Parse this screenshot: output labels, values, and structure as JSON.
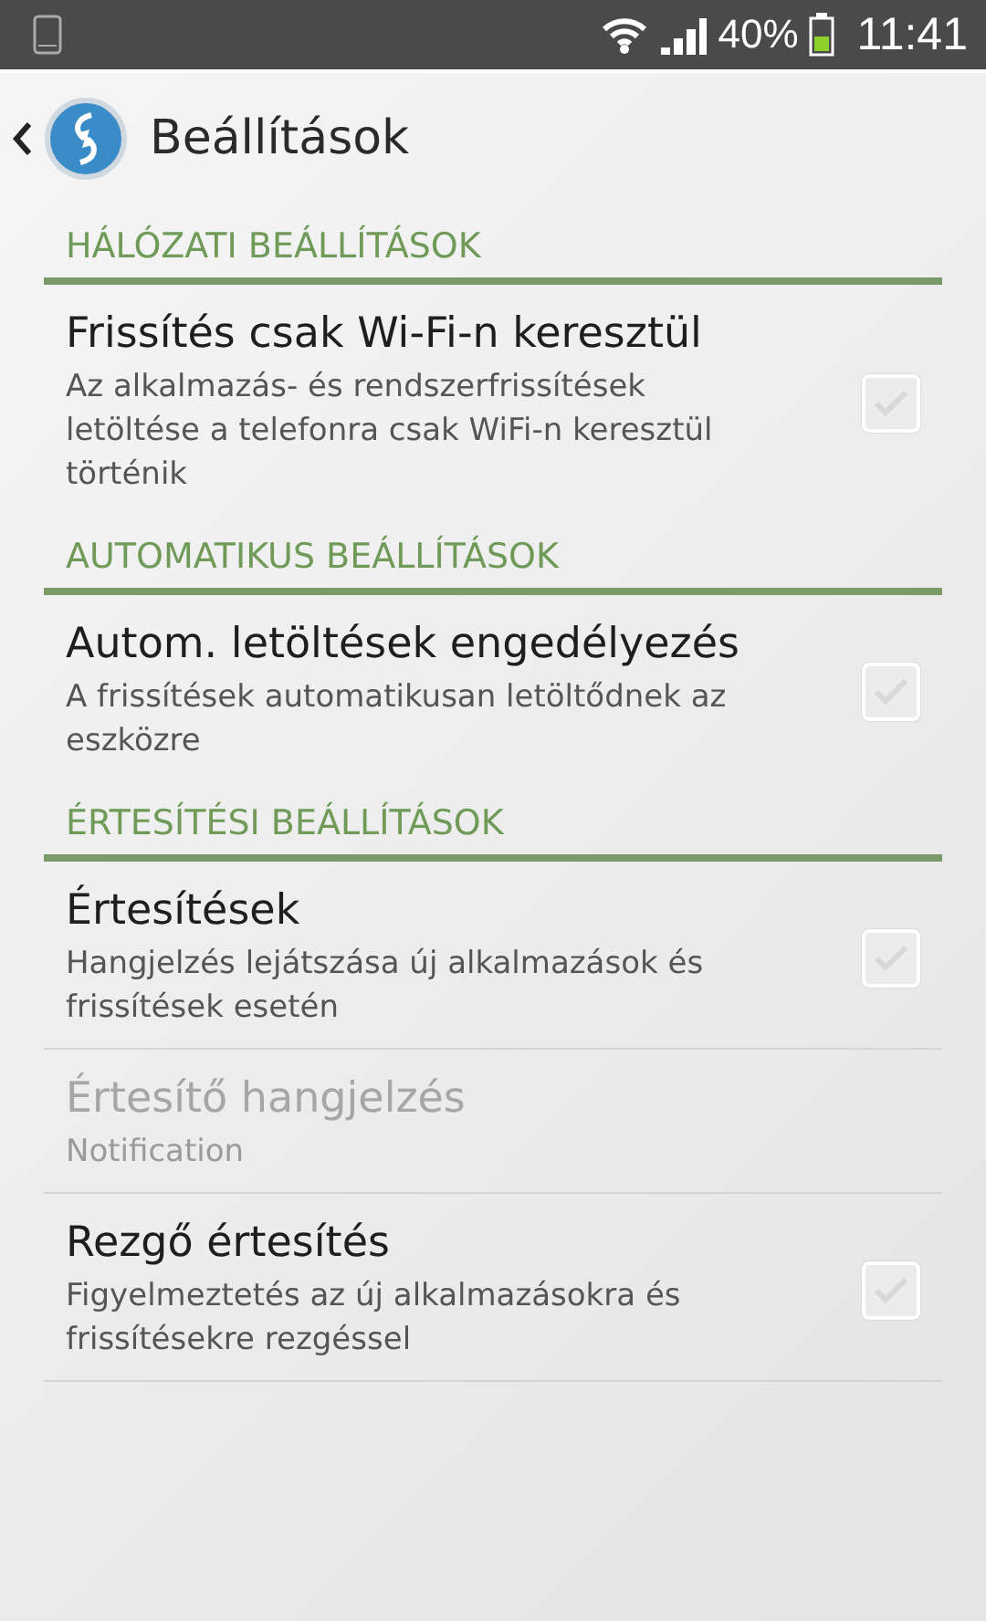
{
  "status_bar": {
    "battery": "40%",
    "time": "11:41"
  },
  "action_bar": {
    "title": "Beállítások"
  },
  "sections": [
    {
      "header": "HÁLÓZATI BEÁLLÍTÁSOK",
      "items": [
        {
          "kind": "checkbox",
          "title": "Frissítés csak Wi-Fi-n keresztül",
          "summary": "Az alkalmazás- és rendszerfrissítések letöltése a telefonra csak WiFi-n keresztül történik",
          "checked": false,
          "disabled": false
        }
      ]
    },
    {
      "header": "AUTOMATIKUS BEÁLLÍTÁSOK",
      "items": [
        {
          "kind": "checkbox",
          "title": "Autom. letöltések engedélyezés",
          "summary": "A frissítések automatikusan letöltődnek az eszközre",
          "checked": false,
          "disabled": false
        }
      ]
    },
    {
      "header": "ÉRTESÍTÉSI BEÁLLÍTÁSOK",
      "items": [
        {
          "kind": "checkbox",
          "title": "Értesítések",
          "summary": "Hangjelzés lejátszása új alkalmazások és frissítések esetén",
          "checked": false,
          "disabled": false
        },
        {
          "kind": "plain",
          "title": "Értesítő hangjelzés",
          "summary": "Notification",
          "disabled": true
        },
        {
          "kind": "checkbox",
          "title": "Rezgő értesítés",
          "summary": "Figyelmeztetés az új alkalmazásokra és frissítésekre rezgéssel",
          "checked": false,
          "disabled": false
        }
      ]
    }
  ]
}
